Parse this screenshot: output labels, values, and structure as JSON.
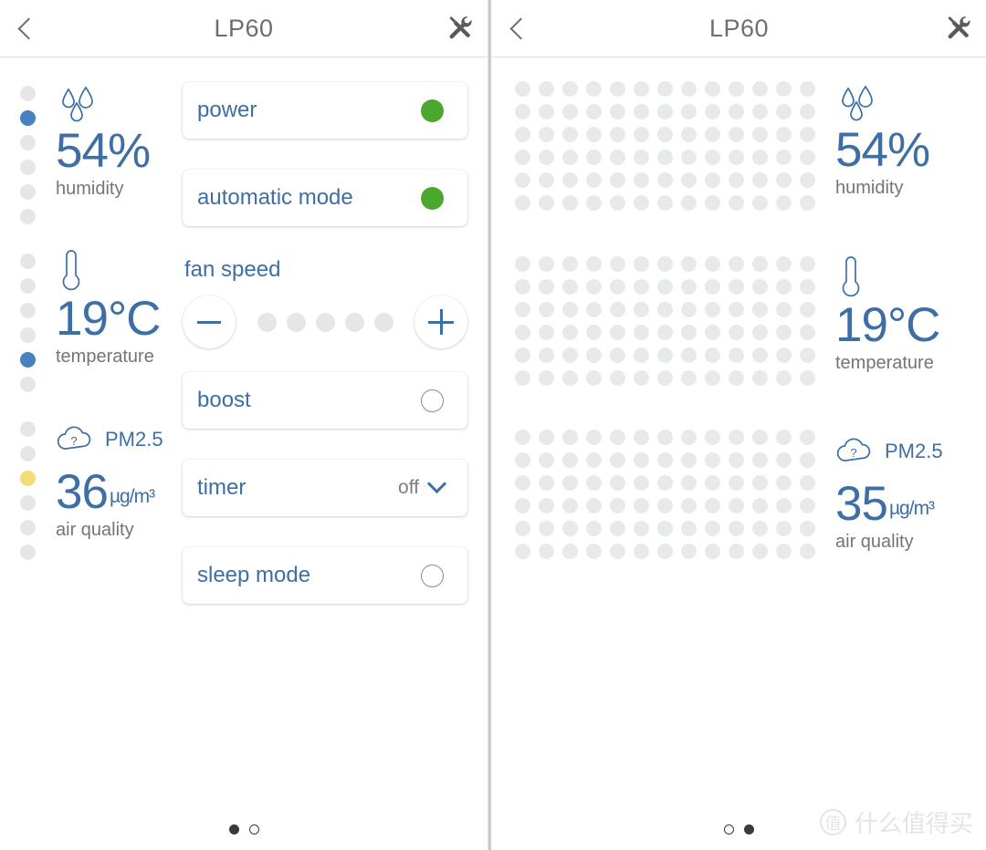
{
  "app": {
    "device_name": "LP60",
    "back_icon": "chevron-left-icon",
    "tools_icon": "tools-wrench-icon"
  },
  "colors": {
    "blue": "#3d6fa5",
    "blue_dot": "#4781c0",
    "green": "#4aa82c",
    "yellow": "#f2dc76",
    "grey_dot": "#e6e6e6",
    "grid_dot": "#e8eaea",
    "label_grey": "#757575"
  },
  "page1": {
    "sensors": [
      {
        "name": "humidity",
        "icon": "water-drops-icon",
        "value": "54",
        "unit": "%",
        "label": "humidity",
        "scale_total": 6,
        "scale_active_index": 1,
        "scale_active_color": "blue"
      },
      {
        "name": "temperature",
        "icon": "thermometer-icon",
        "value": "19",
        "unit": "°C",
        "label": "temperature",
        "scale_total": 6,
        "scale_active_index": 4,
        "scale_active_color": "blue"
      },
      {
        "name": "air-quality",
        "icon": "cloud-question-icon",
        "badge": "PM2.5",
        "value": "36",
        "unit": "µg/m³",
        "label": "air quality",
        "scale_total": 6,
        "scale_active_index": 2,
        "scale_active_color": "yellow"
      }
    ],
    "cards": {
      "power": {
        "label": "power",
        "state": "on"
      },
      "automatic_mode": {
        "label": "automatic mode",
        "state": "on"
      },
      "boost": {
        "label": "boost",
        "state": "off"
      },
      "timer": {
        "label": "timer",
        "value": "off",
        "chevron": "chevron-down-icon"
      },
      "sleep_mode": {
        "label": "sleep mode",
        "state": "off"
      }
    },
    "fan_speed": {
      "title": "fan speed",
      "minus_label": "−",
      "plus_label": "+",
      "steps": 5,
      "current": 0
    },
    "pager": {
      "pages": 2,
      "active": 0
    }
  },
  "page2": {
    "charts": [
      {
        "name": "humidity-history",
        "columns": 13,
        "rows": 6,
        "filled": 0
      },
      {
        "name": "temperature-history",
        "columns": 13,
        "rows": 6,
        "filled": 0
      },
      {
        "name": "air-quality-history",
        "columns": 13,
        "rows": 6,
        "filled": 0
      }
    ],
    "sensors": [
      {
        "name": "humidity",
        "icon": "water-drops-icon",
        "value": "54",
        "unit": "%",
        "label": "humidity"
      },
      {
        "name": "temperature",
        "icon": "thermometer-icon",
        "value": "19",
        "unit": "°C",
        "label": "temperature"
      },
      {
        "name": "air-quality",
        "icon": "cloud-question-icon",
        "badge": "PM2.5",
        "value": "35",
        "unit": "µg/m³",
        "label": "air quality"
      }
    ],
    "pager": {
      "pages": 2,
      "active": 1
    }
  },
  "watermark": {
    "badge": "值",
    "text": "什么值得买"
  }
}
